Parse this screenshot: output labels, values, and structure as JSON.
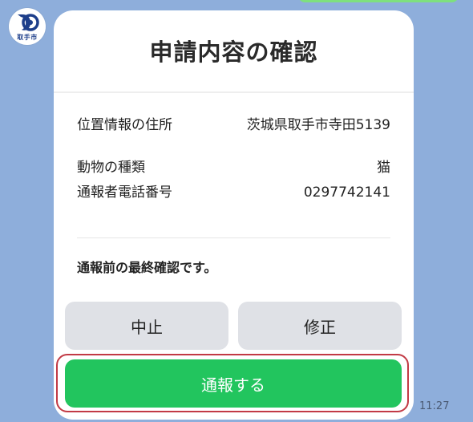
{
  "avatar": {
    "label": "取手市",
    "icon": "city-emblem-icon",
    "brand_color": "#1d3e8a"
  },
  "card": {
    "title": "申請内容の確認",
    "rows": [
      {
        "label": "位置情報の住所",
        "value": "茨城県取手市寺田5139"
      },
      {
        "label": "動物の種類",
        "value": "猫"
      },
      {
        "label": "通報者電話番号",
        "value": "0297742141"
      }
    ],
    "final_note": "通報前の最終確認です。",
    "buttons": {
      "cancel": "中止",
      "edit": "修正",
      "submit": "通報する"
    }
  },
  "timestamp": "11:27",
  "colors": {
    "background": "#8eaedb",
    "submit": "#22c55e",
    "secondary_button": "#dfe1e6",
    "highlight": "#c23a45"
  }
}
